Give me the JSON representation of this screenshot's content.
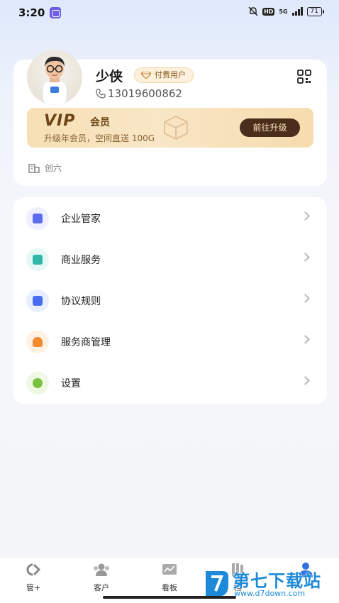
{
  "status_bar": {
    "time": "3:20",
    "network": "5G",
    "hd": "HD",
    "battery": "71"
  },
  "profile": {
    "name": "少侠",
    "badge": "付费用户",
    "phone": "13019600862",
    "company": "创六"
  },
  "vip_banner": {
    "logo": "VIP",
    "member_label": "会员",
    "description": "升级年会员，空间直送 100G",
    "button": "前往升级"
  },
  "menu": {
    "items": [
      {
        "label": "企业管家",
        "icon": "enterprise-icon",
        "color": "#5b6cf0",
        "bg": "#eef0ff"
      },
      {
        "label": "商业服务",
        "icon": "shop-bag-icon",
        "color": "#2fb7a8",
        "bg": "#e6f8f6"
      },
      {
        "label": "协议规则",
        "icon": "document-icon",
        "color": "#4a6cf0",
        "bg": "#eaefff"
      },
      {
        "label": "服务商管理",
        "icon": "person-icon",
        "color": "#f28a2e",
        "bg": "#fff1e4"
      },
      {
        "label": "设置",
        "icon": "settings-icon",
        "color": "#79c23f",
        "bg": "#eef8e4"
      }
    ]
  },
  "tab_bar": {
    "tabs": [
      {
        "label": "管+",
        "icon": "manage-icon"
      },
      {
        "label": "客户",
        "icon": "customers-icon"
      },
      {
        "label": "看板",
        "icon": "dashboard-icon"
      },
      {
        "label": "档",
        "icon": "archive-icon"
      },
      {
        "label": "",
        "icon": "profile-icon"
      }
    ]
  },
  "watermark": {
    "title": "第七下载站",
    "url": "www.d7down.com"
  },
  "colors": {
    "vip_dark": "#4a2e1b",
    "vip_gold": "#f6dfb4",
    "brand_blue": "#1d8ad9"
  }
}
